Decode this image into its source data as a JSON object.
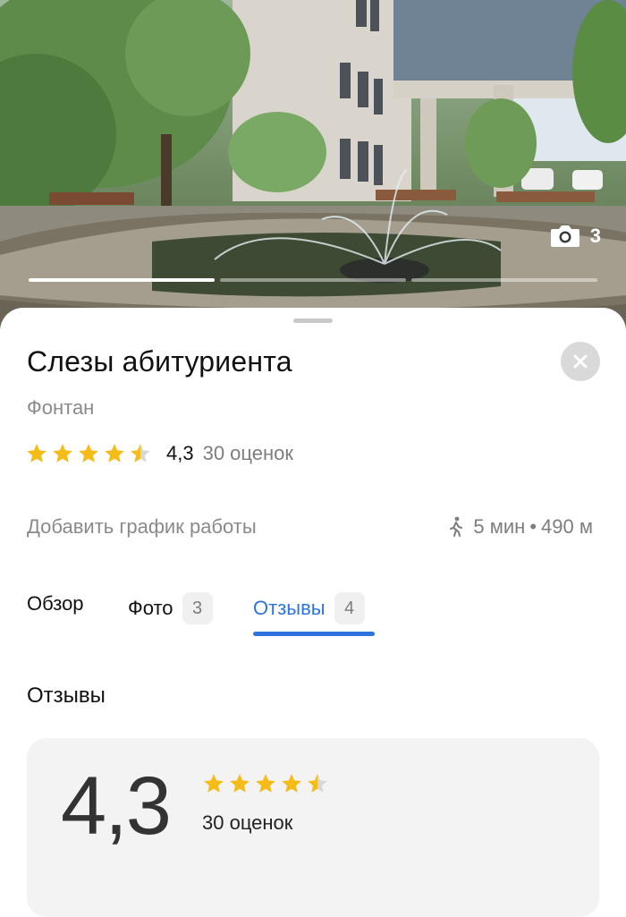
{
  "photo": {
    "count": "3",
    "icon": "camera-icon",
    "progress": {
      "total": 3,
      "active": 0
    }
  },
  "place": {
    "title": "Слезы абитуриента",
    "category": "Фонтан",
    "rating": "4,3",
    "rating_count": "30 оценок",
    "stars_value": 4.3
  },
  "info": {
    "schedule_label": "Добавить график работы",
    "walk_time": "5 мин",
    "separator": "•",
    "distance": "490 м"
  },
  "tabs": [
    {
      "label": "Обзор",
      "count": ""
    },
    {
      "label": "Фото",
      "count": "3"
    },
    {
      "label": "Отзывы",
      "count": "4",
      "active": true
    }
  ],
  "reviews": {
    "title": "Отзывы",
    "rating": "4,3",
    "count": "30 оценок"
  },
  "colors": {
    "accent": "#2f73e0",
    "star": "#f5bb17",
    "star_empty": "#d7d7d7",
    "card_bg": "#f3f3f3"
  }
}
